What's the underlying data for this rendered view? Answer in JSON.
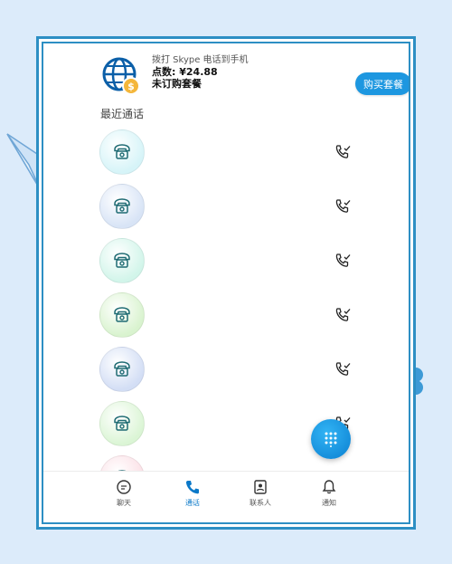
{
  "promo": {
    "line1": "拨打 Skype 电话到手机",
    "line2": "点数: ¥24.88",
    "line3": "未订购套餐",
    "button": "购买套餐"
  },
  "recent_title": "最近通话",
  "calls": [
    {
      "avatar_color": "#d6f4f8"
    },
    {
      "avatar_color": "#d8e4f6"
    },
    {
      "avatar_color": "#d2f5ea"
    },
    {
      "avatar_color": "#d9f3cf"
    },
    {
      "avatar_color": "#d3def5"
    },
    {
      "avatar_color": "#dbf5d5"
    },
    {
      "avatar_color": "#fbe0e6"
    }
  ],
  "tabs": {
    "chat": "聊天",
    "calls": "通话",
    "contacts": "联系人",
    "notifications": "通知"
  },
  "colors": {
    "accent": "#1d97e0",
    "frame": "#2d8fc4",
    "background": "#dcebfa"
  }
}
